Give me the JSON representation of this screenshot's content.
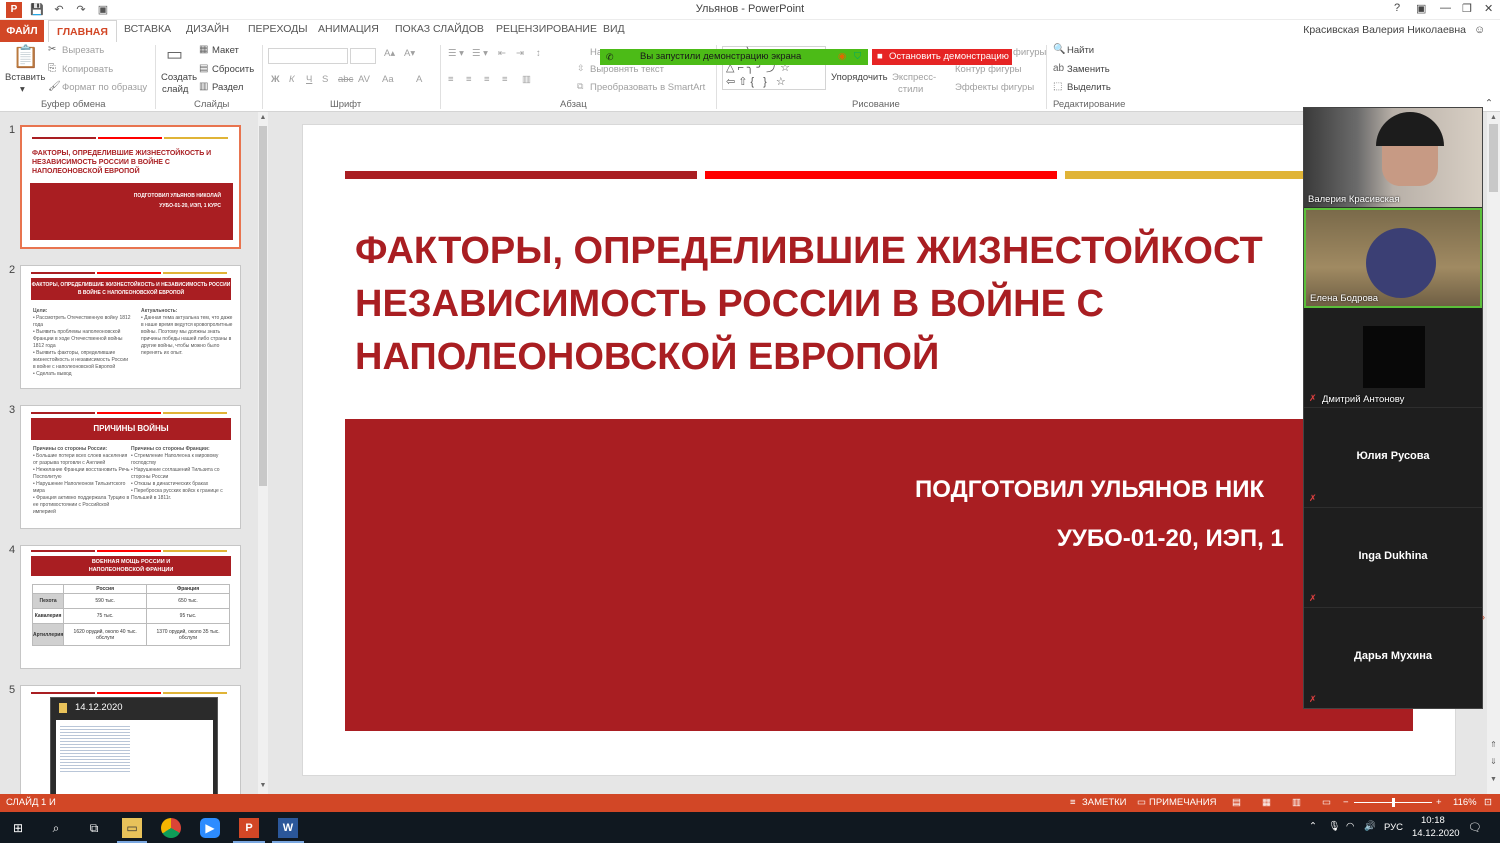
{
  "window": {
    "title": "Ульянов - PowerPoint",
    "help": "?",
    "min": "—",
    "restore": "❐",
    "close": "✕"
  },
  "qat": {
    "save": "💾",
    "undo": "↶",
    "redo": "↷",
    "present": "▣"
  },
  "tabs": {
    "file": "ФАЙЛ",
    "items": [
      "ГЛАВНАЯ",
      "ВСТАВКА",
      "ДИЗАЙН",
      "ПЕРЕХОДЫ",
      "АНИМАЦИЯ",
      "ПОКАЗ СЛАЙДОВ",
      "РЕЦЕНЗИРОВАНИЕ",
      "ВИД"
    ],
    "active": "ГЛАВНАЯ"
  },
  "user": "Красивская Валерия Николаевна",
  "ribbon": {
    "paste": "Вставить",
    "cut": "Вырезать",
    "copy": "Копировать",
    "format_painter": "Формат по образцу",
    "clipboard_group": "Буфер обмена",
    "new_slide_1": "Создать",
    "new_slide_2": "слайд",
    "layout": "Макет",
    "reset": "Сбросить",
    "section": "Раздел",
    "slides_group": "Слайды",
    "font_group": "Шрифт",
    "font_bold": "Ж",
    "font_italic": "К",
    "font_underline": "Ч",
    "font_shadow": "S",
    "font_strike": "abc",
    "font_spacing": "AV",
    "font_case": "Aa",
    "font_color": "A",
    "align_text": "Выровнять текст",
    "smartart": "Преобразовать в SmartArt",
    "paragraph_group": "Абзац",
    "textdir": "На",
    "arrange": "Упорядочить",
    "quick_styles_1": "Экспресс-",
    "quick_styles_2": "стили",
    "shape_outline": "Контур фигуры",
    "shape_effects": "Эффекты фигуры",
    "shape_fill": "фигуры",
    "drawing_group": "Рисование",
    "find": "Найти",
    "replace": "Заменить",
    "select": "Выделить",
    "editing_group": "Редактирование"
  },
  "screen_share": {
    "banner": "Вы запустили демонстрацию экрана",
    "stop": "Остановить демонстрацию"
  },
  "thumbnails": {
    "nums": [
      "1",
      "2",
      "3",
      "4",
      "5"
    ],
    "s1": {
      "title": "ФАКТОРЫ, ОПРЕДЕЛИВШИЕ ЖИЗНЕСТОЙКОСТЬ И НЕЗАВИСИМОСТЬ РОССИИ В ВОЙНЕ С НАПОЛЕОНОВСКОЙ ЕВРОПОЙ",
      "sub1": "ПОДГОТОВИЛ УЛЬЯНОВ НИКОЛАЙ",
      "sub2": "УУБО-01-20, ИЭП, 1 КУРС"
    },
    "s2": {
      "header": "ФАКТОРЫ, ОПРЕДЕЛИВШИЕ ЖИЗНЕСТОЙКОСТЬ И НЕЗАВИСИМОСТЬ РОССИИ В ВОЙНЕ С НАПОЛЕОНОВСКОЙ ЕВРОПОЙ",
      "left_title": "Цели:",
      "left": "• Рассмотреть Отечественную войну 1812 года\n• Выявить проблемы наполеоновской Франции в ходе Отечественной войны 1812 года\n• Выявить факторы, определившие жизнестойкость и независимость России в войне с наполеоновской Европой\n• Сделать вывод",
      "right_title": "Актуальность:",
      "right": "• Данная тема актуальна тем, что даже в наше время ведутся кровопролитные войны. Поэтому мы должны знать причины победы нашей либо страны в другие войны, чтобы можно было перенять их опыт."
    },
    "s3": {
      "header": "ПРИЧИНЫ ВОЙНЫ",
      "left_title": "Причины со стороны России:",
      "left": "• Большие потери всех слоев населения от разрыва торговли с Англией\n• Нежелание Франции восстановить Речь Посполитую\n• Нарушение Наполеоном Тильзитского мира\n• Франция активно поддержала Турцию в ее противостоянии с Российской империей",
      "right_title": "Причины со стороны Франции:",
      "right": "• Стремление Наполеона к мировому господству\n• Нарушение соглашений Тильзита со стороны России\n• Отказы в династических браках\n• Переброска русских войск к границе с Польшей в 1811г."
    },
    "s4": {
      "header": "ВОЕННАЯ МОЩЬ РОССИИ И НАПОЛЕОНОВСКОЙ ФРАНЦИИ",
      "cols": [
        "",
        "Россия",
        "Франция"
      ],
      "rows": [
        [
          "Пехота",
          "590 тыс.",
          "650 тыс."
        ],
        [
          "Кавалерия",
          "75 тыс.",
          "95 тыс."
        ],
        [
          "Артиллерия",
          "1620 орудий, около 40 тыс. обслуги",
          "1370 орудий, около 35 тыс. обслуги"
        ]
      ]
    },
    "popup_date": "14.12.2020"
  },
  "slide": {
    "title": "ФАКТОРЫ, ОПРЕДЕЛИВШИЕ ЖИЗНЕСТОЙКОСТ\nНЕЗАВИСИМОСТЬ РОССИИ В ВОЙНЕ С\nНАПОЛЕОНОВСКОЙ ЕВРОПОЙ",
    "author": "ПОДГОТОВИЛ УЛЬЯНОВ НИК",
    "group": "УУБО-01-20, ИЭП, 1"
  },
  "participants": [
    {
      "name": "Валерия Красивская",
      "video": true
    },
    {
      "name": "Елена Бодрова",
      "video": true
    },
    {
      "name": "Дмитрий Антонову",
      "video": false
    },
    {
      "name": "Юлия Русова",
      "video": false
    },
    {
      "name": "Inga Dukhina",
      "video": false
    },
    {
      "name": "Дарья Мухина",
      "video": false
    }
  ],
  "status": {
    "slide": "СЛАЙД 1 И",
    "notes": "ЗАМЕТКИ",
    "comments": "ПРИМЕЧАНИЯ",
    "zoom": "116%"
  },
  "taskbar": {
    "lang": "РУС",
    "time": "10:18",
    "date": "14.12.2020"
  },
  "colors": {
    "accent": "#d24726",
    "slide_red": "#a91e22",
    "stripe_dark": "#a91e22",
    "stripe_red": "#ff0000",
    "stripe_gold": "#e0b437",
    "share_green": "#4cbb17",
    "stop_red": "#e62424"
  }
}
